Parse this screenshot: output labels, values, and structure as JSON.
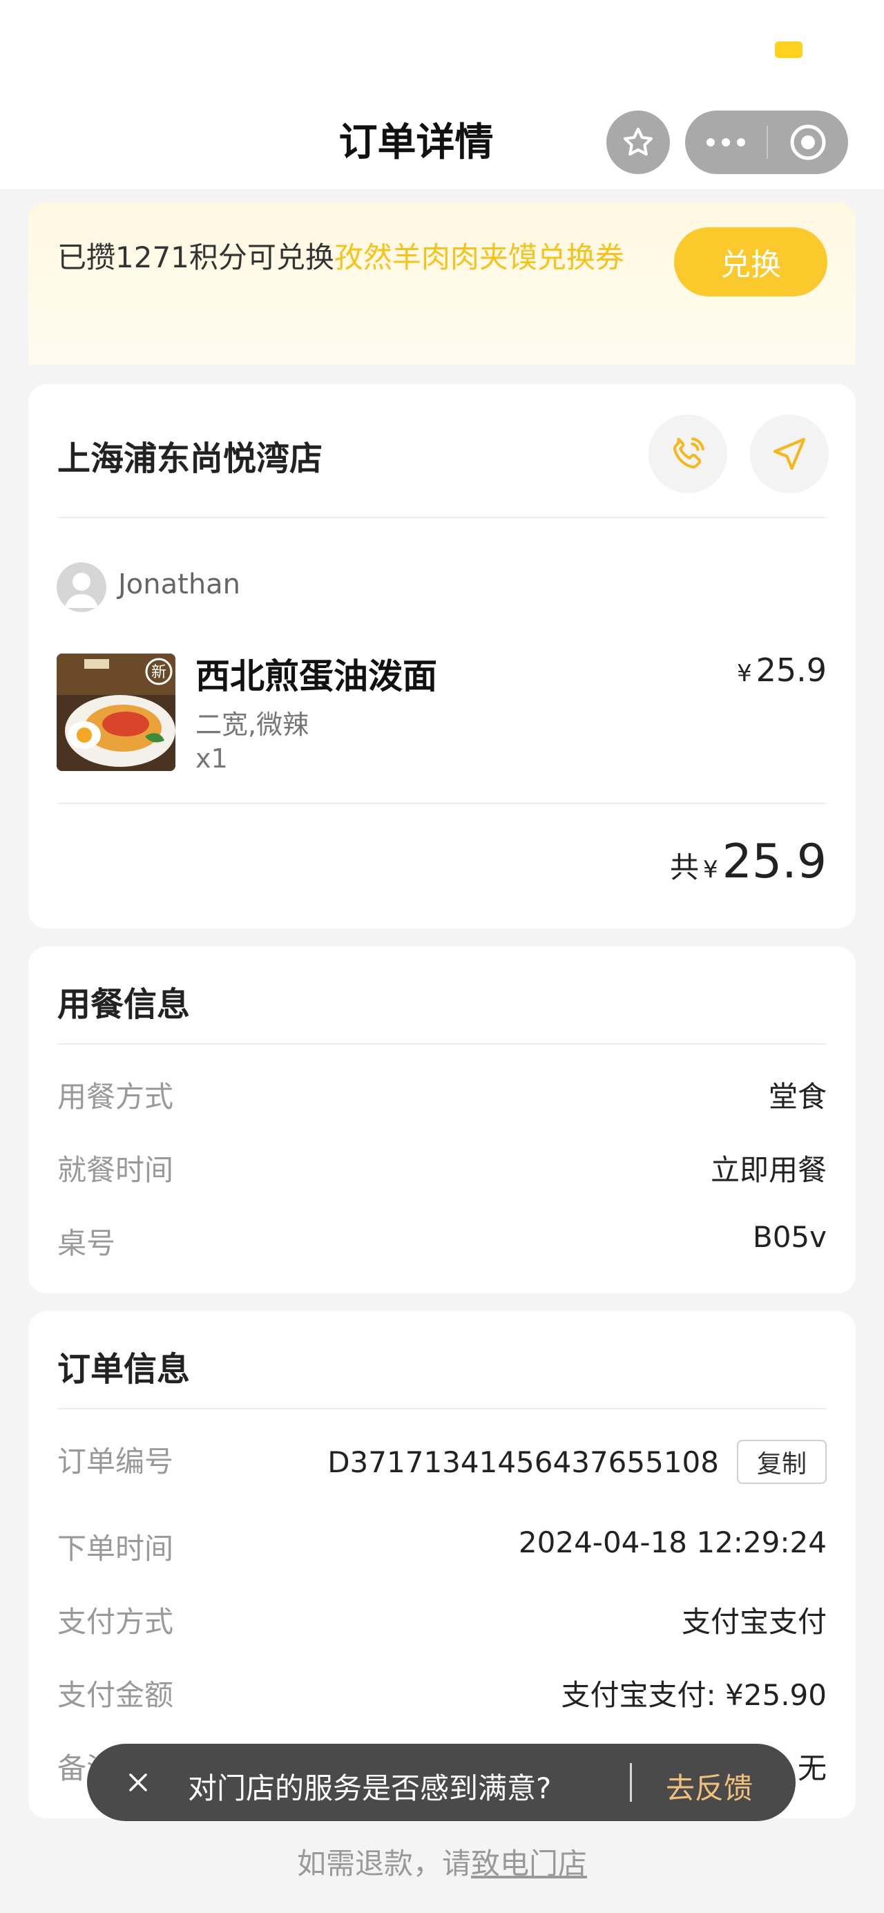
{
  "nav": {
    "title": "订单详情"
  },
  "banner": {
    "prefix": "已攒1271积分可兑换",
    "highlight": "孜然羊肉肉夹馍兑换券",
    "button": "兑换"
  },
  "store": {
    "name": "上海浦东尚悦湾店",
    "user": "Jonathan",
    "item": {
      "name": "西北煎蛋油泼面",
      "spec": "二宽,微辣",
      "qty": "x1",
      "currency": "¥",
      "price": "25.9",
      "badge": "新"
    },
    "total": {
      "label": "共",
      "currency": "¥",
      "amount": "25.9"
    }
  },
  "dining": {
    "title": "用餐信息",
    "rows": [
      {
        "label": "用餐方式",
        "value": "堂食"
      },
      {
        "label": "就餐时间",
        "value": "立即用餐"
      },
      {
        "label": "桌号",
        "value": "B05v"
      }
    ]
  },
  "order": {
    "title": "订单信息",
    "copy_label": "复制",
    "rows": [
      {
        "label": "订单编号",
        "value": "D37171341456437655108"
      },
      {
        "label": "下单时间",
        "value": "2024-04-18 12:29:24"
      },
      {
        "label": "支付方式",
        "value": "支付宝支付"
      },
      {
        "label": "支付金额",
        "value": "支付宝支付: ¥25.90"
      },
      {
        "label": "备注信息",
        "value": "无"
      }
    ]
  },
  "toast": {
    "text": "对门店的服务是否感到满意?",
    "action": "去反馈"
  },
  "footer": {
    "prefix": "如需退款，请",
    "link": "致电门店"
  },
  "colors": {
    "accent": "#fbc92b",
    "highlight": "#f5c41c",
    "toast_action": "#f2c07d"
  }
}
